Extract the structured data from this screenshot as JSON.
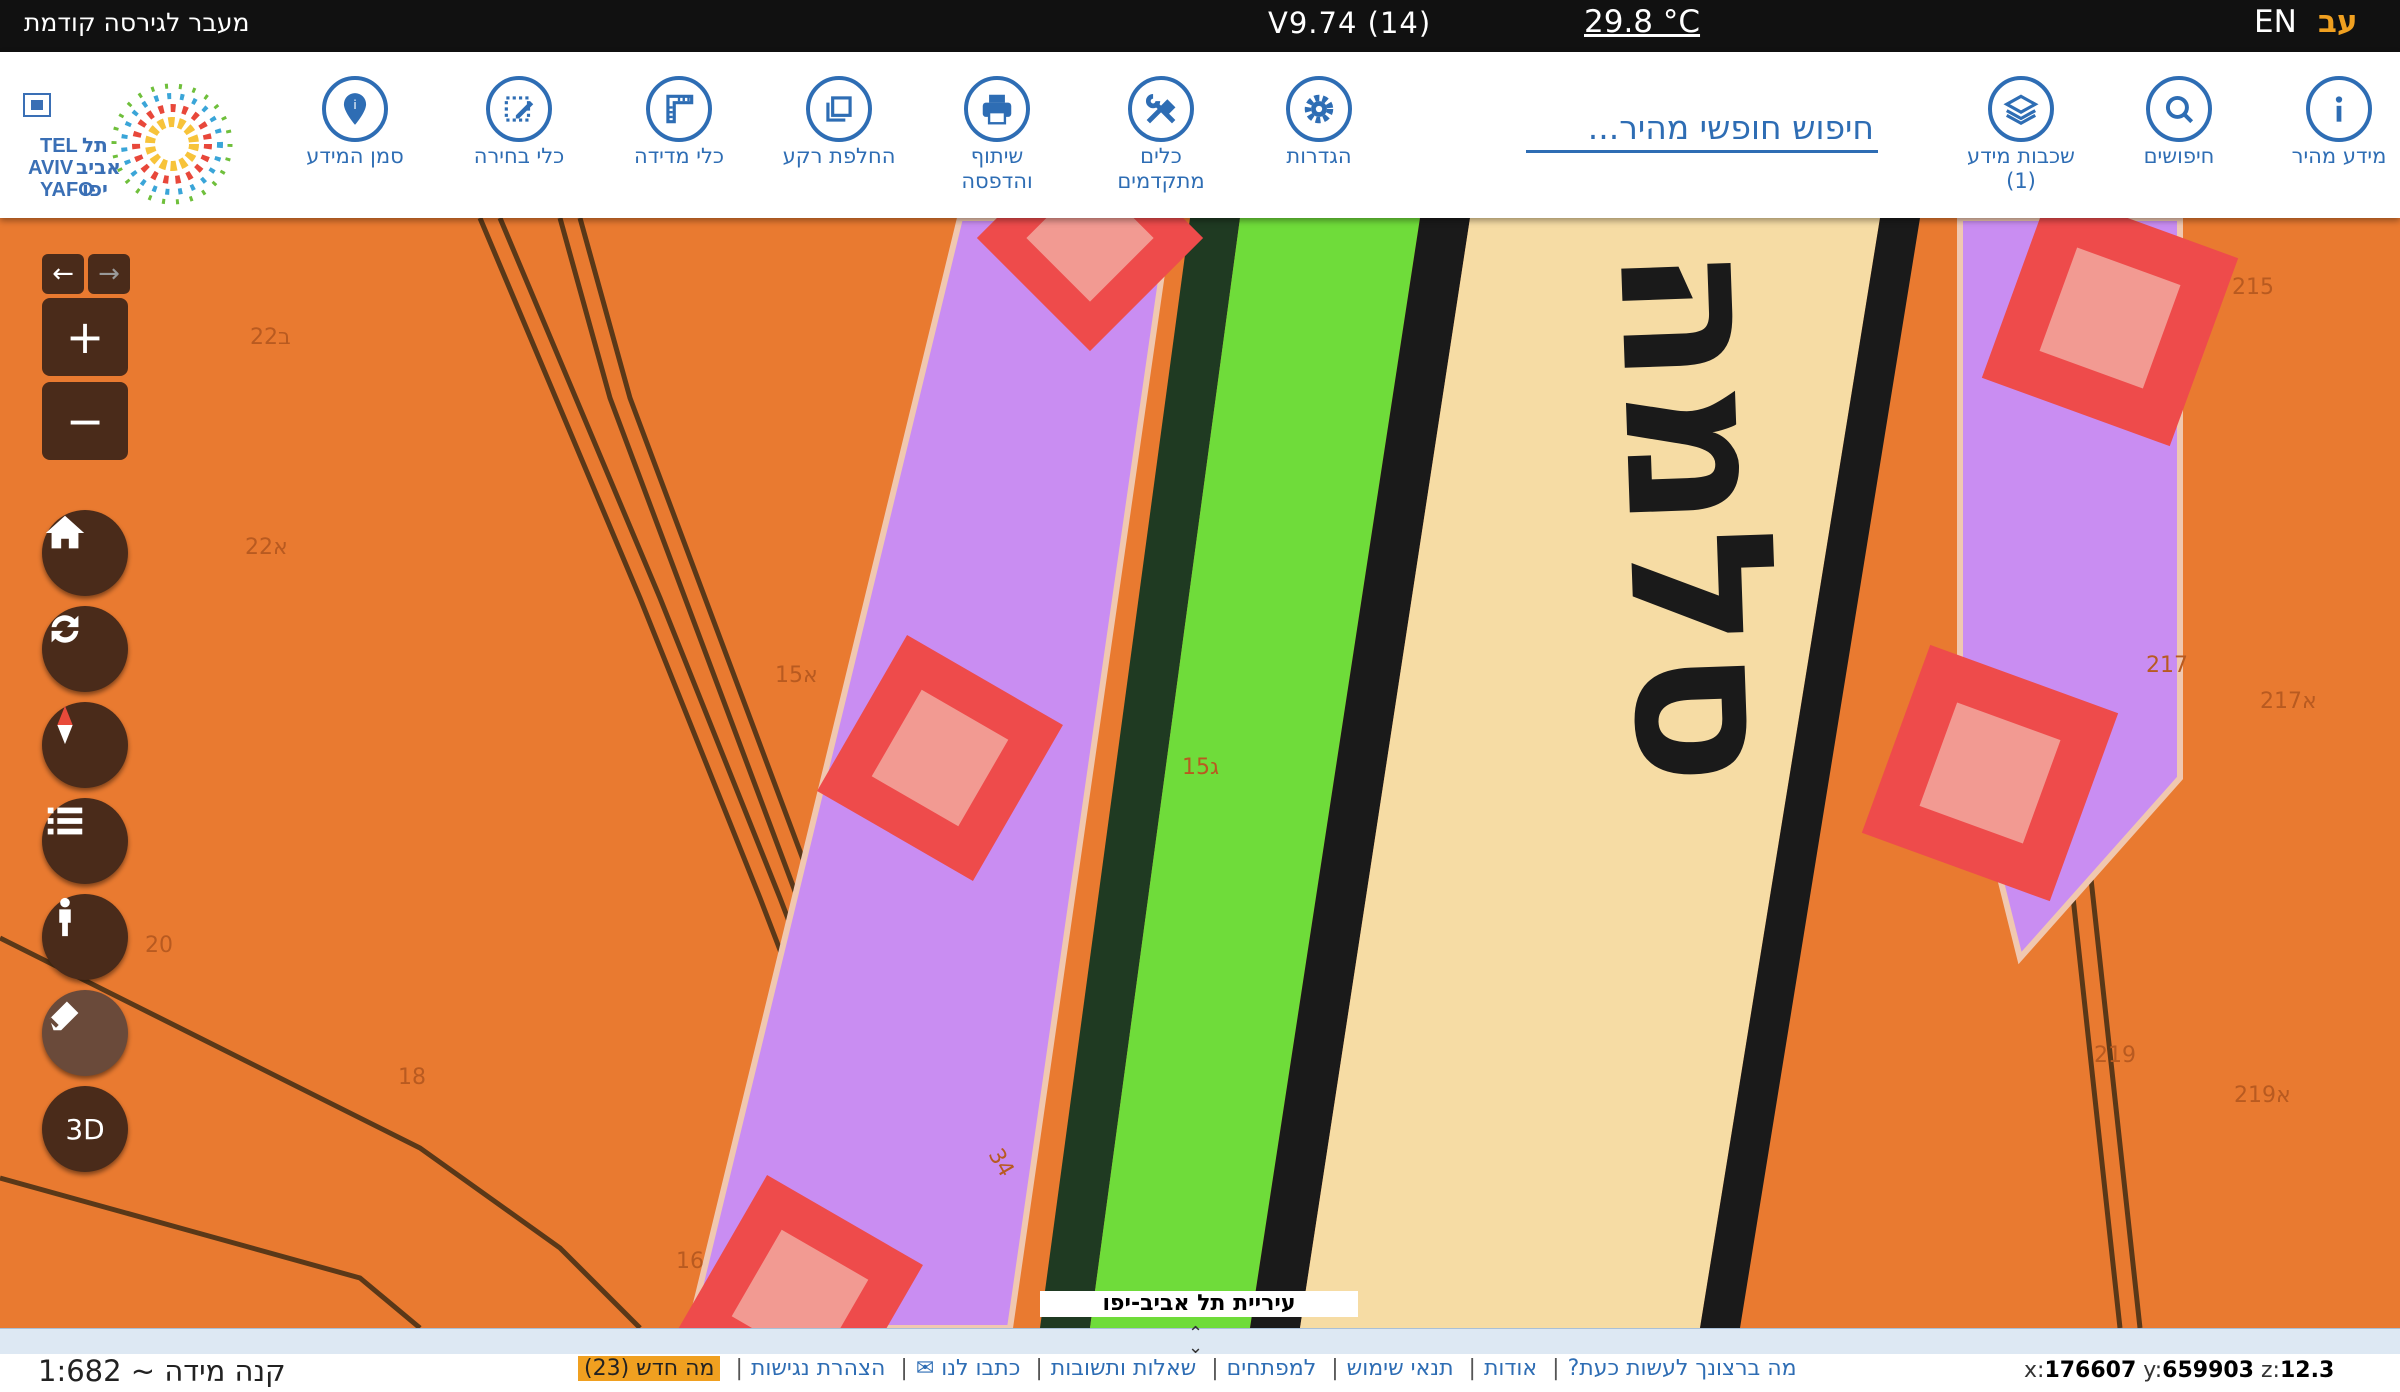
{
  "topbar": {
    "prev_version": "מעבר לגירסה קודמת",
    "version": "V9.74 (14)",
    "temperature": "29.8 °C",
    "lang_en": "EN",
    "lang_he": "עב"
  },
  "toolbar": {
    "tools": {
      "quick_info": "מידע מהיר",
      "searches": "חיפושים",
      "layers": "שכבות מידע",
      "layers_count": "(1)",
      "settings": "הגדרות",
      "advanced_1": "כלים",
      "advanced_2": "מתקדמים",
      "share_1": "שיתוף",
      "share_2": "והדפסה",
      "basemap": "החלפת רקע",
      "measure": "כלי מדידה",
      "select": "כלי בחירה",
      "info_marker": "סמן המידע"
    },
    "search_placeholder": "חיפוש חופשי מהיר...",
    "logo_text": {
      "tel": "TEL",
      "aviv": "AVIV",
      "yafo": "YAFO",
      "he_tel": "תל",
      "he_aviv": "אביב",
      "he_yafo": "יפו"
    }
  },
  "map": {
    "parcel_labels": [
      "22ב",
      "22א",
      "15א",
      "15ג",
      "20",
      "18",
      "16",
      "34",
      "215",
      "217",
      "217א",
      "219",
      "219א"
    ],
    "road_text": "סלמה",
    "source_label": "עיריית תל אביב-יפו"
  },
  "map_controls": {
    "back": "←",
    "forward": "→",
    "zoom_in": "+",
    "zoom_out": "−",
    "three_d": "3D"
  },
  "bottombar": {
    "coords": {
      "x_label": "x:",
      "x": "176607",
      "y_label": "y:",
      "y": "659903",
      "z_label": "z:",
      "z": "12.3"
    },
    "links": [
      "מה ברצונך לעשות כעת?",
      "אודות",
      "תנאי שימוש",
      "למפתחים",
      "שאלות ותשובות",
      "כתבו לנו ✉",
      "הצהרת נגישות"
    ],
    "whats_new": "מה חדש (23)",
    "scale": "קנה מידה ~ 1:682"
  },
  "colors": {
    "background_orange": "#e97a30",
    "purple_strip": "#c98df2",
    "green_strip": "#6fdc3a",
    "road_fill": "#f6dca4",
    "marker_red": "#ee4b4b",
    "marker_pink": "#f29a92",
    "control_brown": "#4a2b1a",
    "accent_blue": "#2e6db4",
    "badge_orange": "#f0a020"
  }
}
